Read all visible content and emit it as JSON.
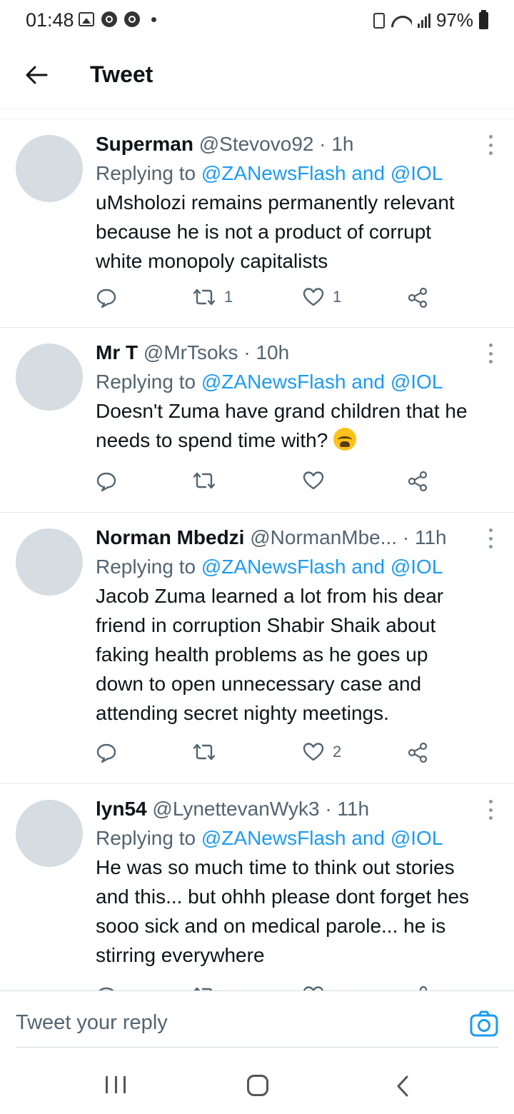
{
  "status_bar": {
    "time": "01:48",
    "battery": "97%"
  },
  "header": {
    "title": "Tweet"
  },
  "tweets": [
    {
      "name": "Superman",
      "handle": "@Stevovo92",
      "time": "1h",
      "replying_label": "Replying to",
      "replying_to": "@ZANewsFlash and @IOL",
      "text": "uMsholozi remains permanently relevant because he is not a product of corrupt white monopoly capitalists",
      "retweets": "1",
      "likes": "1"
    },
    {
      "name": "Mr T",
      "handle": "@MrTsoks",
      "time": "10h",
      "replying_label": "Replying to",
      "replying_to": "@ZANewsFlash and @IOL",
      "text": "Doesn't Zuma have grand children that he needs to spend time with?",
      "emoji": "loudly-crying-face",
      "retweets": "",
      "likes": ""
    },
    {
      "name": "Norman Mbedzi",
      "handle": "@NormanMbe...",
      "time": "11h",
      "replying_label": "Replying to",
      "replying_to": "@ZANewsFlash and @IOL",
      "text": "Jacob Zuma learned a lot from his dear friend in corruption Shabir Shaik about faking health problems as he  goes up down to open unnecessary case and attending secret nighty meetings.",
      "retweets": "",
      "likes": "2"
    },
    {
      "name": "lyn54",
      "handle": "@LynettevanWyk3",
      "time": "11h",
      "replying_label": "Replying to",
      "replying_to": "@ZANewsFlash and @IOL",
      "text": "He was so much time to think out stories and this... but ohhh please dont forget hes sooo sick and on medical parole... he is stirring everywhere",
      "retweets": "",
      "likes": ""
    }
  ],
  "composer": {
    "placeholder": "Tweet your reply"
  },
  "icons": {
    "back": "arrow-left-icon",
    "more": "more-vertical-icon",
    "reply": "comment-icon",
    "retweet": "retweet-icon",
    "like": "heart-icon",
    "share": "share-icon",
    "camera": "camera-icon"
  },
  "colors": {
    "accent": "#1d9bf0",
    "muted": "#536471",
    "text": "#0f1419",
    "avatar": "#d5dce2"
  }
}
